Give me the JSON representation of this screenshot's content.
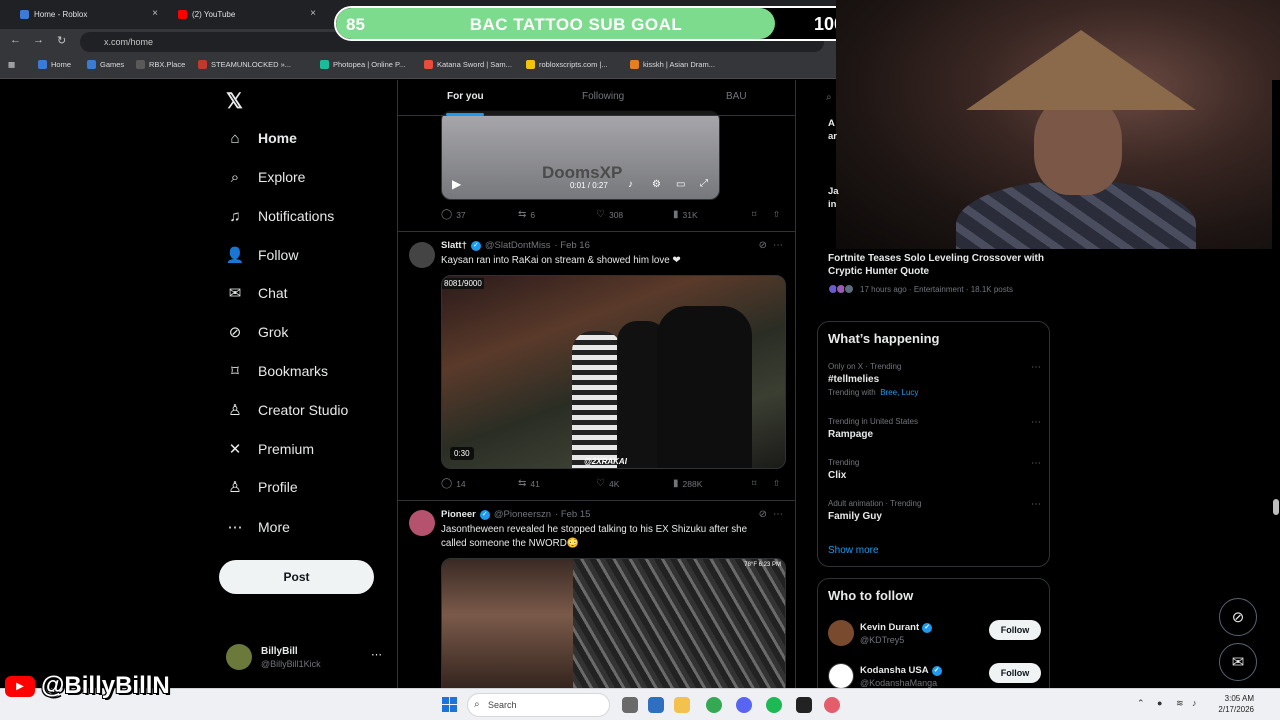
{
  "browser": {
    "tabs": [
      {
        "label": "Home - Roblox",
        "color": "#3a7bd5",
        "active": false
      },
      {
        "label": "(2) YouTube",
        "color": "#ff0000",
        "active": false
      }
    ],
    "url": "x.com/home",
    "bookmarks": [
      "Home",
      "Games",
      "RBX.Place",
      "STEAMUNLOCKED »...",
      "Photopea | Online P...",
      "Katana Sword | Sam...",
      "robloxscripts.com |...",
      "kisskh | Asian Dram..."
    ]
  },
  "goal_overlay": {
    "start": "85",
    "title": "BAC TATTOO SUB GOAL",
    "end": "100",
    "progress": 0.85
  },
  "left_nav": {
    "items": [
      {
        "label": "Home",
        "icon": "home-icon",
        "glyph": "⌂"
      },
      {
        "label": "Explore",
        "icon": "search-icon",
        "glyph": "⌕"
      },
      {
        "label": "Notifications",
        "icon": "bell-icon",
        "glyph": "♫"
      },
      {
        "label": "Follow",
        "icon": "follow-icon",
        "glyph": "👤"
      },
      {
        "label": "Chat",
        "icon": "mail-icon",
        "glyph": "✉"
      },
      {
        "label": "Grok",
        "icon": "grok-icon",
        "glyph": "⊘"
      },
      {
        "label": "Bookmarks",
        "icon": "bookmark-icon",
        "glyph": "⌑"
      },
      {
        "label": "Creator Studio",
        "icon": "creator-studio-icon",
        "glyph": "♙"
      },
      {
        "label": "Premium",
        "icon": "premium-icon",
        "glyph": "✕"
      },
      {
        "label": "Profile",
        "icon": "profile-icon",
        "glyph": "♙"
      },
      {
        "label": "More",
        "icon": "more-icon",
        "glyph": "⋯"
      }
    ],
    "post_label": "Post",
    "account": {
      "name": "BillyBill",
      "handle": "@BillyBill1Kick"
    }
  },
  "feed": {
    "tabs": [
      "For you",
      "Following",
      "BAU"
    ],
    "post1": {
      "video_watermark": "DoomsXP",
      "time": "0:01 / 0:27",
      "stats": {
        "replies": "37",
        "reposts": "6",
        "likes": "308",
        "views": "31K"
      }
    },
    "post2": {
      "name": "Slatt†",
      "handle": "@SlatDontMiss",
      "date": "· Feb 16",
      "text": "Kaysan ran into RaKai on stream & showed him love ❤",
      "overlay_counter": "8081/9000",
      "duration": "0:30",
      "tag": "@2XRAKAI",
      "stats": {
        "replies": "14",
        "reposts": "41",
        "likes": "4K",
        "views": "288K"
      }
    },
    "post3": {
      "name": "Pioneer",
      "handle": "@Pioneerszn",
      "date": "· Feb 15",
      "text": "Jasontheween revealed he stopped talking to his EX Shizuku after she called someone the NWORD😳",
      "cam_label": "78°F 6:23 PM"
    }
  },
  "right": {
    "fragments": [
      "A",
      "ar",
      "Ja",
      "in"
    ],
    "trend_card": {
      "title": "Fortnite Teases Solo Leveling Crossover with Cryptic Hunter Quote",
      "meta": "17 hours ago · Entertainment · 18.1K posts"
    },
    "whats_happening": {
      "title": "What’s happening",
      "trends": [
        {
          "context": "Only on X · Trending",
          "name": "#tellmelies",
          "with_prefix": "Trending with",
          "with_names": "Bree, Lucy"
        },
        {
          "context": "Trending in United States",
          "name": "Rampage"
        },
        {
          "context": "Trending",
          "name": "Clix"
        },
        {
          "context": "Adult animation · Trending",
          "name": "Family Guy"
        }
      ],
      "show_more": "Show more"
    },
    "who_to_follow": {
      "title": "Who to follow",
      "accounts": [
        {
          "name": "Kevin Durant",
          "handle": "@KDTrey5",
          "button": "Follow",
          "avatar_color": "#7a4a2e"
        },
        {
          "name": "Kodansha USA",
          "handle": "@KodanshaManga",
          "button": "Follow",
          "avatar_color": "#ffffff"
        }
      ]
    }
  },
  "taskbar": {
    "search": "Search",
    "time": "3:05 AM",
    "date": "2/17/2026"
  },
  "watermark": {
    "handle": "@BillyBillN"
  },
  "colors": {
    "accent": "#1d9bf0",
    "goal_fill": "#7ddb8e",
    "like_red": "#f91880"
  }
}
